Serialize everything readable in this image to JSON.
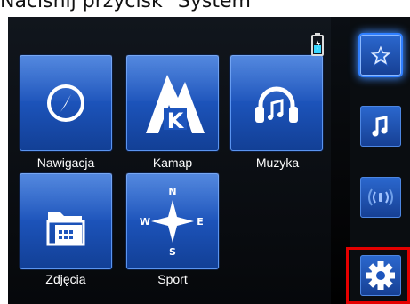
{
  "instruction": "Naciśnij przycisk \"System\"",
  "apps": [
    {
      "label": "Nawigacja",
      "icon": "compass-icon"
    },
    {
      "label": "Kamap",
      "icon": "kamap-logo-icon"
    },
    {
      "label": "Muzyka",
      "icon": "headphones-icon"
    },
    {
      "label": "Zdjęcia",
      "icon": "photo-folder-icon"
    },
    {
      "label": "Sport",
      "icon": "compass-rose-icon"
    }
  ],
  "compass_letters": {
    "n": "N",
    "w": "W",
    "e": "E",
    "s": "S"
  },
  "kamap_letter": "K",
  "sidebar": [
    {
      "icon": "star-icon",
      "active": true
    },
    {
      "icon": "music-note-icon",
      "active": false
    },
    {
      "icon": "sound-waves-icon",
      "active": false
    },
    {
      "icon": "gear-icon",
      "active": false,
      "highlighted": true
    }
  ],
  "colors": {
    "tile_blue": "#1d55bd",
    "highlight_red": "#e50000",
    "glow": "#3f8cff"
  },
  "status": {
    "battery_icon": "battery-charging-icon"
  }
}
